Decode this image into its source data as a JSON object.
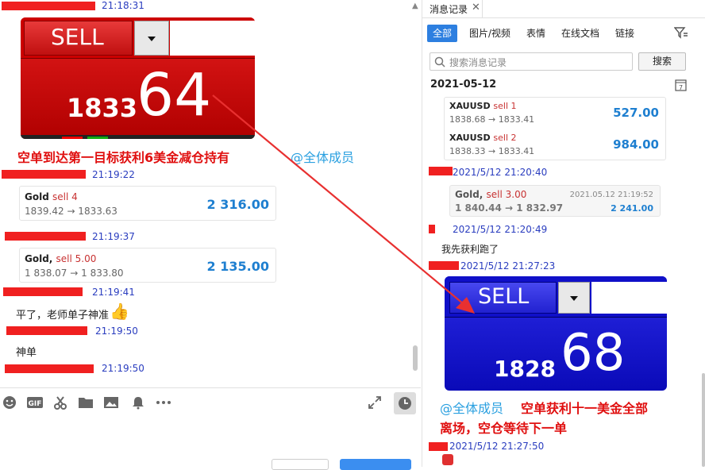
{
  "left": {
    "msgs": [
      {
        "time": "21:18:31"
      },
      {
        "time": "21:19:22"
      },
      {
        "time": "21:19:37"
      },
      {
        "time": "21:19:41"
      },
      {
        "time": "21:19:50"
      },
      {
        "time": "21:19:50"
      }
    ],
    "sell_image": {
      "label": "SELL",
      "price_small": "1833",
      "price_big": "64"
    },
    "caption": "空单到达第一目标获利6美金减仓持有",
    "mention": "@全体成员",
    "card1": {
      "name": "Gold",
      "side": "sell 4",
      "from_to": "1839.42 → 1833.63",
      "value": "2 316.00"
    },
    "card2": {
      "name": "Gold,",
      "side": "sell 5.00",
      "from_to": "1 838.07 → 1 833.80",
      "value": "2 135.00"
    },
    "text1": "平了，老师单子神准",
    "thumb": "👍",
    "text2": "神单"
  },
  "right": {
    "panel_title": "消息记录",
    "tabs": [
      "全部",
      "图片/视频",
      "表情",
      "在线文档",
      "链接"
    ],
    "search_placeholder": "搜索消息记录",
    "search_button": "搜索",
    "date": "2021-05-12",
    "card1": {
      "name": "XAUUSD",
      "side": "sell 1",
      "from_to": "1838.68 → 1833.41",
      "value": "527.00"
    },
    "card2": {
      "name": "XAUUSD",
      "side": "sell 2",
      "from_to": "1838.33 → 1833.41",
      "value": "984.00"
    },
    "t1": "2021/5/12 21:20:40",
    "card3": {
      "name": "Gold,",
      "side": "sell 3.00",
      "from_to": "1 840.44 → 1 832.97",
      "date": "2021.05.12 21:19:52",
      "value": "2 241.00"
    },
    "t2": "2021/5/12 21:20:49",
    "text1": "我先获利跑了",
    "t3": "2021/5/12 21:27:23",
    "sell_image": {
      "label": "SELL",
      "price_small": "1828",
      "price_big": "68"
    },
    "mention": "@全体成员",
    "caption1": "空单获利十一美金全部",
    "caption2": "离场，空仓等待下一单",
    "t4": "2021/5/12 21:27:50"
  }
}
